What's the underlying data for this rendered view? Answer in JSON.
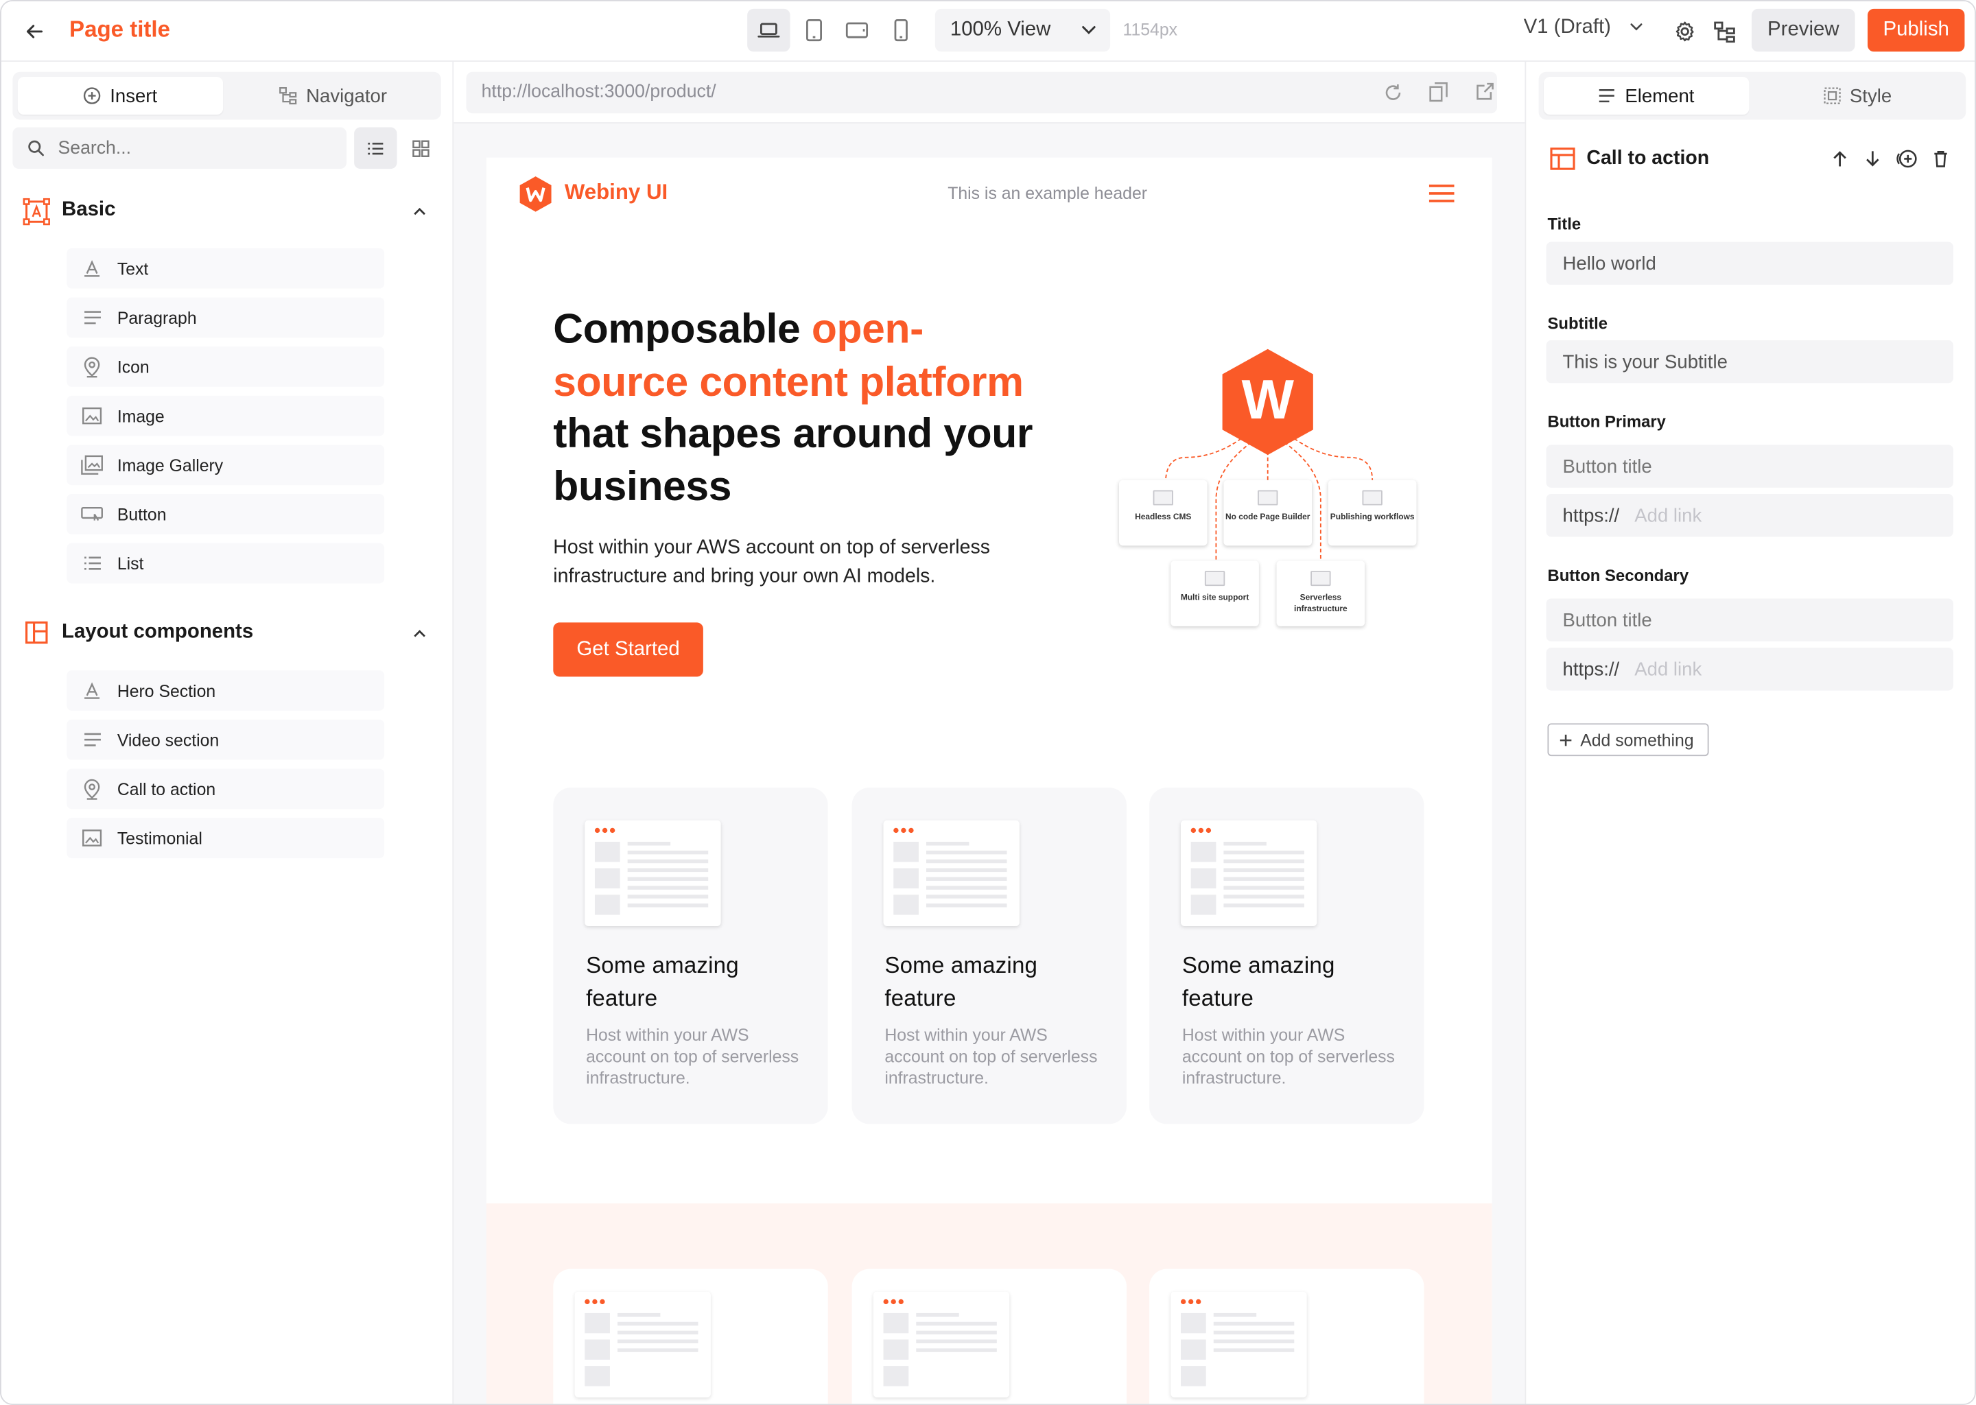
{
  "topbar": {
    "page_title": "Page title",
    "view_select": "100% View",
    "width_readout": "1154px",
    "version": "V1 (Draft)",
    "preview_label": "Preview",
    "publish_label": "Publish"
  },
  "left_panel": {
    "tabs": {
      "insert": "Insert",
      "navigator": "Navigator"
    },
    "search_placeholder": "Search...",
    "groups": [
      {
        "title": "Basic",
        "items": [
          "Text",
          "Paragraph",
          "Icon",
          "Image",
          "Image Gallery",
          "Button",
          "List"
        ]
      },
      {
        "title": "Layout components",
        "items": [
          "Hero Section",
          "Video section",
          "Call to action",
          "Testimonial"
        ]
      }
    ]
  },
  "canvas": {
    "url": "http://localhost:3000/product/",
    "site": {
      "brand": "Webiny UI",
      "header_text": "This is an example header",
      "hero": {
        "title_part1": "Composable ",
        "title_highlight": "open-source content platform",
        "title_part2": " that shapes around your business",
        "description": "Host within your AWS account on top of serverless infrastructure and bring your own AI models.",
        "cta": "Get Started"
      },
      "diagram": {
        "logo_letter": "W",
        "nodes": [
          "Headless CMS",
          "No code Page Builder",
          "Publishing workflows",
          "Multi site support",
          "Serverless infrastructure"
        ]
      },
      "features": [
        {
          "title": "Some amazing feature",
          "text": "Host within your AWS account on top of serverless infrastructure."
        },
        {
          "title": "Some amazing feature",
          "text": "Host within your AWS account on top of serverless infrastructure."
        },
        {
          "title": "Some amazing feature",
          "text": "Host within your AWS account on top of serverless infrastructure."
        }
      ]
    }
  },
  "right_panel": {
    "tabs": {
      "element": "Element",
      "style": "Style"
    },
    "element_name": "Call to action",
    "fields": {
      "title_label": "Title",
      "title_value": "Hello world",
      "subtitle_label": "Subtitle",
      "subtitle_value": "This is your Subtitle",
      "button_primary_label": "Button Primary",
      "button_primary_title_placeholder": "Button title",
      "button_primary_link_prefix": "https://",
      "button_primary_link_placeholder": "Add link",
      "button_secondary_label": "Button Secondary",
      "button_secondary_title_placeholder": "Button title",
      "button_secondary_link_prefix": "https://",
      "button_secondary_link_placeholder": "Add link"
    },
    "add_something": "Add something"
  },
  "colors": {
    "accent": "#fa5a28",
    "panel_bg": "#f4f4f6",
    "section_tint": "#fff4f1"
  }
}
